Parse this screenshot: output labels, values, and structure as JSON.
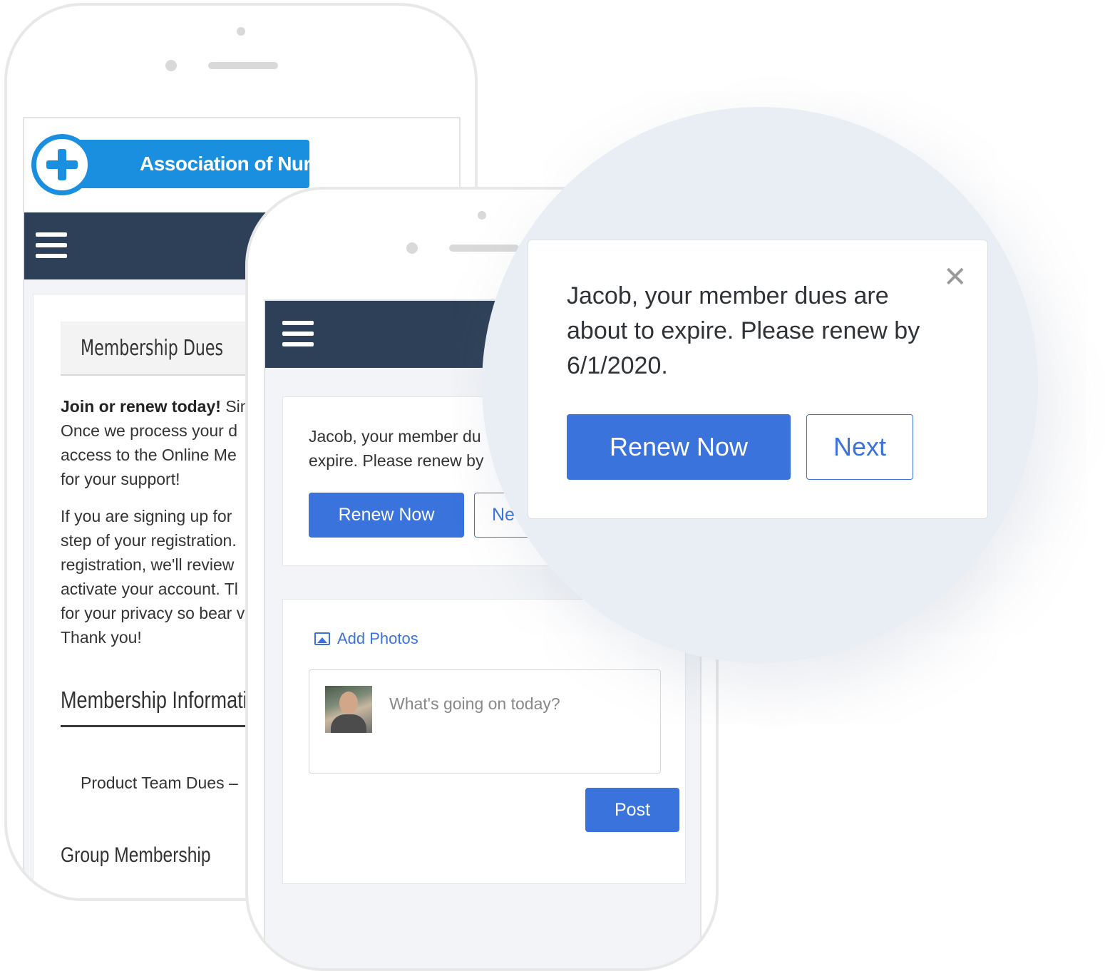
{
  "brand": {
    "name": "Association of Nurses",
    "primary_color": "#1a8fe0",
    "nav_color": "#2d4057",
    "accent_color": "#3a73dc"
  },
  "back_phone": {
    "menu_icon": "hamburger-icon",
    "tab_label": "Membership Dues",
    "intro_bold": "Join or renew today!",
    "intro_lines": [
      " Sin",
      "Once we process your d",
      "access to the Online Me",
      "for your support!"
    ],
    "para2_lines": [
      "If you are signing up for",
      "step of your registration.",
      "registration, we'll review",
      "activate your account. Tl",
      "for your privacy so bear v",
      "Thank you!"
    ],
    "info_heading": "Membership Information",
    "product_line": "Product Team Dues –",
    "group_line": "Group Membership"
  },
  "front_phone": {
    "menu_icon": "hamburger-icon",
    "message_lines": [
      "Jacob, your member du",
      "expire. Please renew by"
    ],
    "renew_label": "Renew Now",
    "next_label": "Ne",
    "add_photos_label": "Add Photos",
    "post_placeholder": "What's going on today?",
    "post_label": "Post"
  },
  "zoom_popup": {
    "message": "Jacob, your member dues are about to expire. Please renew by 6/1/2020.",
    "close_icon": "close-icon",
    "renew_label": "Renew Now",
    "next_label": "Next"
  }
}
